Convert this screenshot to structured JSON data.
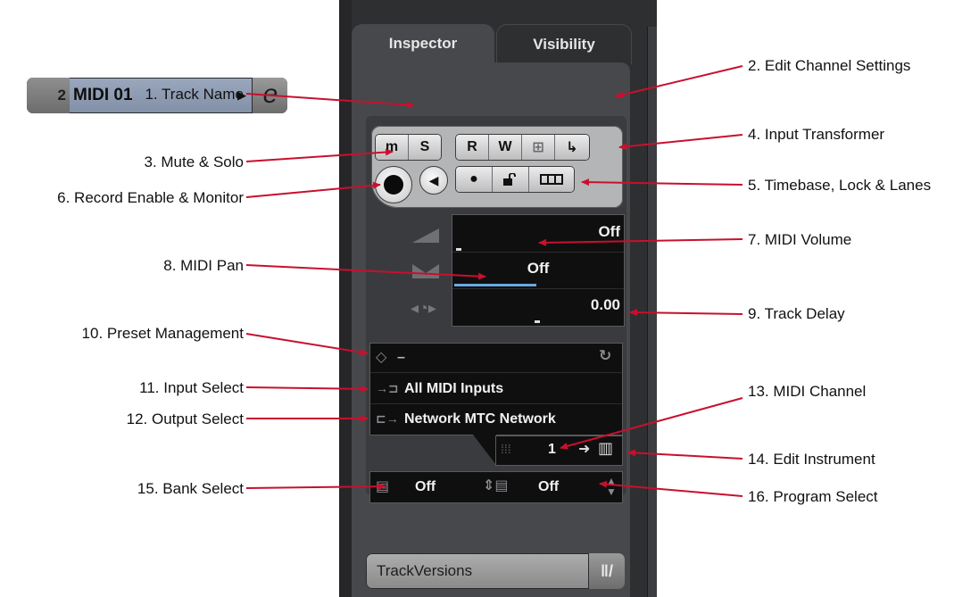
{
  "panel": {
    "tabs": [
      {
        "label": "Inspector",
        "active": true
      },
      {
        "label": "Visibility",
        "active": false
      }
    ],
    "track": {
      "number": "2",
      "name": "MIDI 01",
      "edit_channel_glyph": "e"
    },
    "buttons": {
      "mute": "m",
      "solo": "S",
      "read": "R",
      "write": "W",
      "grid_glyph": "⊞",
      "input_transformer_glyph": "↳",
      "timebase_glyph": "●",
      "lock_glyph": "🔓",
      "lanes_glyph": "▥",
      "monitor_glyph": "◀"
    },
    "faders": {
      "volume": "Off",
      "pan": "Off",
      "delay": "0.00"
    },
    "preset": {
      "text": "–"
    },
    "input": "All MIDI Inputs",
    "output": "Network MTC Network",
    "channel": "1",
    "bank": {
      "value": "Off"
    },
    "program": {
      "value": "Off"
    },
    "track_versions": "TrackVersions",
    "colors": {
      "panel_bg": "#2e2f31",
      "track_bar": "#9aa7bd",
      "arrow": "#c8102e",
      "pan_bar": "#69a9e0"
    }
  },
  "labels": {
    "l1": "1. Track Name",
    "l2": "2. Edit Channel Settings",
    "l3": "3. Mute & Solo",
    "l4": "4. Input Transformer",
    "l5": "5. Timebase, Lock & Lanes",
    "l6": "6. Record Enable & Monitor",
    "l7": "7. MIDI Volume",
    "l8": "8. MIDI Pan",
    "l9": "9. Track Delay",
    "l10": "10. Preset Management",
    "l11": "11. Input Select",
    "l12": "12. Output Select",
    "l13": "13. MIDI Channel",
    "l14": "14. Edit Instrument",
    "l15": "15. Bank Select",
    "l16": "16. Program Select"
  }
}
